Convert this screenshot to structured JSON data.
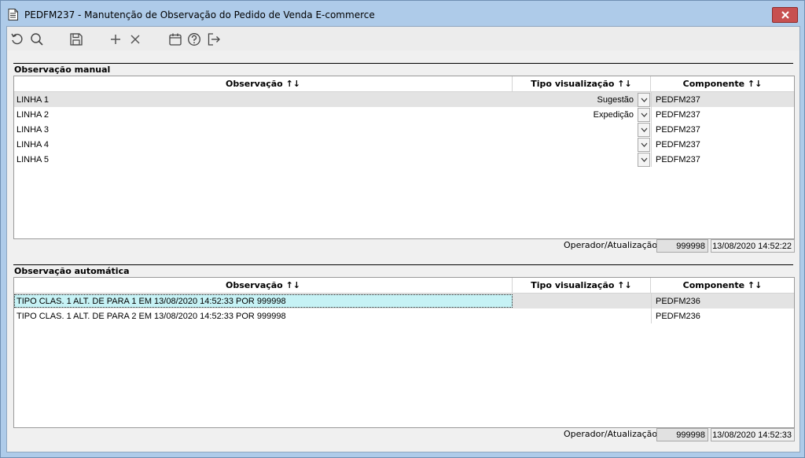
{
  "window": {
    "title": "PEDFM237 - Manutenção de Observação do Pedido de Venda E-commerce"
  },
  "toolbar": {
    "buttons": [
      {
        "name": "refresh-icon"
      },
      {
        "name": "search-icon"
      },
      {
        "name": "save-icon"
      },
      {
        "name": "add-icon"
      },
      {
        "name": "delete-icon"
      },
      {
        "name": "calendar-icon"
      },
      {
        "name": "help-icon"
      },
      {
        "name": "exit-icon"
      }
    ]
  },
  "manual": {
    "title": "Observação manual",
    "headers": {
      "obs": "Observação ↑↓",
      "tipo": "Tipo visualização ↑↓",
      "comp": "Componente ↑↓"
    },
    "rows": [
      {
        "obs": "LINHA 1",
        "tipo": "Sugestão",
        "comp": "PEDFM237"
      },
      {
        "obs": "LINHA 2",
        "tipo": "Expedição",
        "comp": "PEDFM237"
      },
      {
        "obs": "LINHA 3",
        "tipo": "",
        "comp": "PEDFM237"
      },
      {
        "obs": "LINHA 4",
        "tipo": "",
        "comp": "PEDFM237"
      },
      {
        "obs": "LINHA 5",
        "tipo": "",
        "comp": "PEDFM237"
      }
    ],
    "footer": {
      "label": "Operador/Atualização",
      "operator": "999998",
      "timestamp": "13/08/2020 14:52:22"
    }
  },
  "auto": {
    "title": "Observação automática",
    "headers": {
      "obs": "Observação ↑↓",
      "tipo": "Tipo visualização ↑↓",
      "comp": "Componente ↑↓"
    },
    "rows": [
      {
        "obs": "TIPO CLAS. 1 ALT. DE  PARA 1 EM 13/08/2020 14:52:33 POR 999998",
        "tipo": "",
        "comp": "PEDFM236"
      },
      {
        "obs": "TIPO CLAS. 1 ALT. DE  PARA 2 EM 13/08/2020 14:52:33 POR 999998",
        "tipo": "",
        "comp": "PEDFM236"
      }
    ],
    "footer": {
      "label": "Operador/Atualização",
      "operator": "999998",
      "timestamp": "13/08/2020 14:52:33"
    }
  },
  "colors": {
    "titlebar": "#aecbe9",
    "close_button": "#c75050",
    "row_alt": "#e3e3e3",
    "selected_cell": "#c6f2f5"
  }
}
